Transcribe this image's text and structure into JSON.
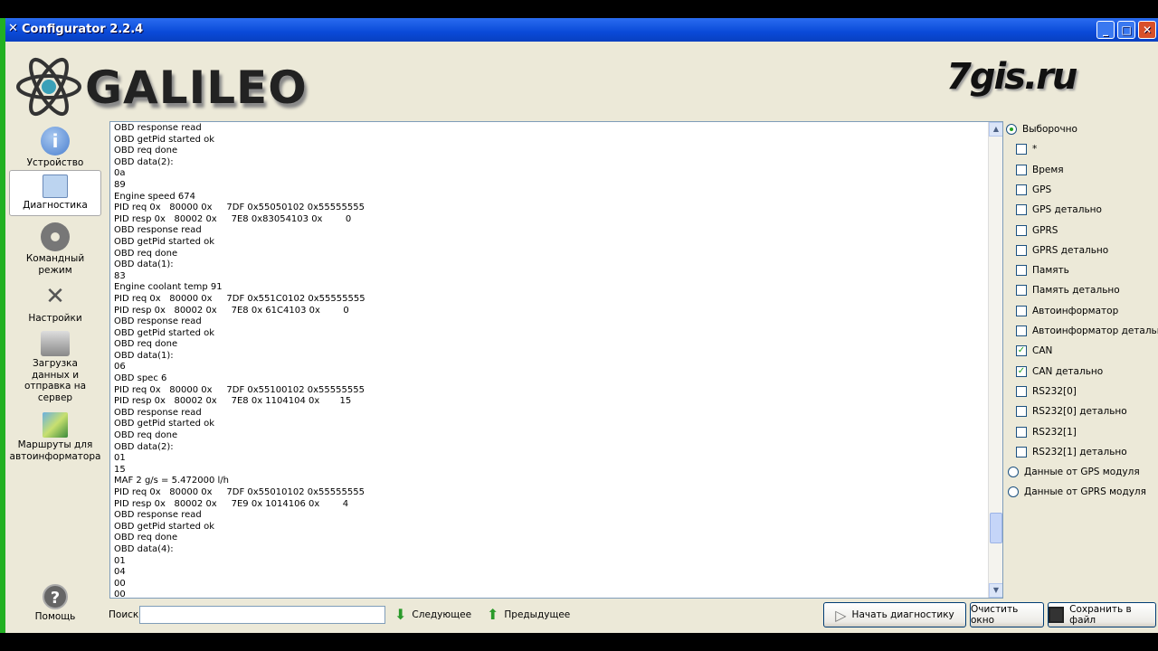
{
  "window": {
    "title": "Configurator 2.2.4",
    "minimize": "_",
    "maximize": "□",
    "close": "✕"
  },
  "logo": {
    "text": "GALILEO"
  },
  "brand": "7gis.ru",
  "sidebar": {
    "items": [
      {
        "label": "Устройство",
        "icon": "info-icon"
      },
      {
        "label": "Диагностика",
        "icon": "chart-icon",
        "active": true
      },
      {
        "label": "Командный режим",
        "icon": "gear-icon"
      },
      {
        "label": "Настройки",
        "icon": "tools-icon"
      },
      {
        "label": "Загрузка данных и отправка на сервер",
        "icon": "upload-icon"
      },
      {
        "label": "Маршруты для автоинформатора",
        "icon": "route-icon"
      }
    ],
    "help": "Помощь"
  },
  "log": {
    "lines": [
      "OBD response read",
      "OBD getPid started ok",
      "OBD req done",
      "OBD data(2):",
      "0a",
      "89",
      "Engine speed 674",
      "PID req 0x   80000 0x     7DF 0x55050102 0x55555555",
      "PID resp 0x   80002 0x     7E8 0x83054103 0x        0",
      "OBD response read",
      "OBD getPid started ok",
      "OBD req done",
      "OBD data(1):",
      "83",
      "Engine coolant temp 91",
      "PID req 0x   80000 0x     7DF 0x551C0102 0x55555555",
      "PID resp 0x   80002 0x     7E8 0x 61C4103 0x        0",
      "OBD response read",
      "OBD getPid started ok",
      "OBD req done",
      "OBD data(1):",
      "06",
      "OBD spec 6",
      "PID req 0x   80000 0x     7DF 0x55100102 0x55555555",
      "PID resp 0x   80002 0x     7E8 0x 1104104 0x       15",
      "OBD response read",
      "OBD getPid started ok",
      "OBD req done",
      "OBD data(2):",
      "01",
      "15",
      "MAF 2 g/s = 5.472000 l/h",
      "PID req 0x   80000 0x     7DF 0x55010102 0x55555555",
      "PID resp 0x   80002 0x     7E9 0x 1014106 0x        4",
      "OBD response read",
      "OBD getPid started ok",
      "OBD req done",
      "OBD data(4):",
      "01",
      "04",
      "00",
      "00"
    ]
  },
  "filters": {
    "mode_selective": "Выборочно",
    "items": [
      {
        "label": "*",
        "checked": false
      },
      {
        "label": "Время",
        "checked": false
      },
      {
        "label": "GPS",
        "checked": false
      },
      {
        "label": "GPS детально",
        "checked": false
      },
      {
        "label": "GPRS",
        "checked": false
      },
      {
        "label": "GPRS детально",
        "checked": false
      },
      {
        "label": "Память",
        "checked": false
      },
      {
        "label": "Память детально",
        "checked": false
      },
      {
        "label": "Автоинформатор",
        "checked": false
      },
      {
        "label": "Автоинформатор детально",
        "checked": false
      },
      {
        "label": "CAN",
        "checked": true
      },
      {
        "label": "CAN детально",
        "checked": true
      },
      {
        "label": "RS232[0]",
        "checked": false
      },
      {
        "label": "RS232[0] детально",
        "checked": false
      },
      {
        "label": "RS232[1]",
        "checked": false
      },
      {
        "label": "RS232[1] детально",
        "checked": false
      }
    ],
    "mode_gps": "Данные от GPS модуля",
    "mode_gprs": "Данные от GPRS модуля"
  },
  "bottom": {
    "search_label": "Поиск",
    "search_value": "",
    "next": "Следующее",
    "prev": "Предыдущее",
    "start": "Начать диагностику",
    "clear": "Очистить окно",
    "save": "Сохранить в файл"
  },
  "colors": {
    "accent": "#21a121",
    "titlebar": "#0a4ad8"
  }
}
